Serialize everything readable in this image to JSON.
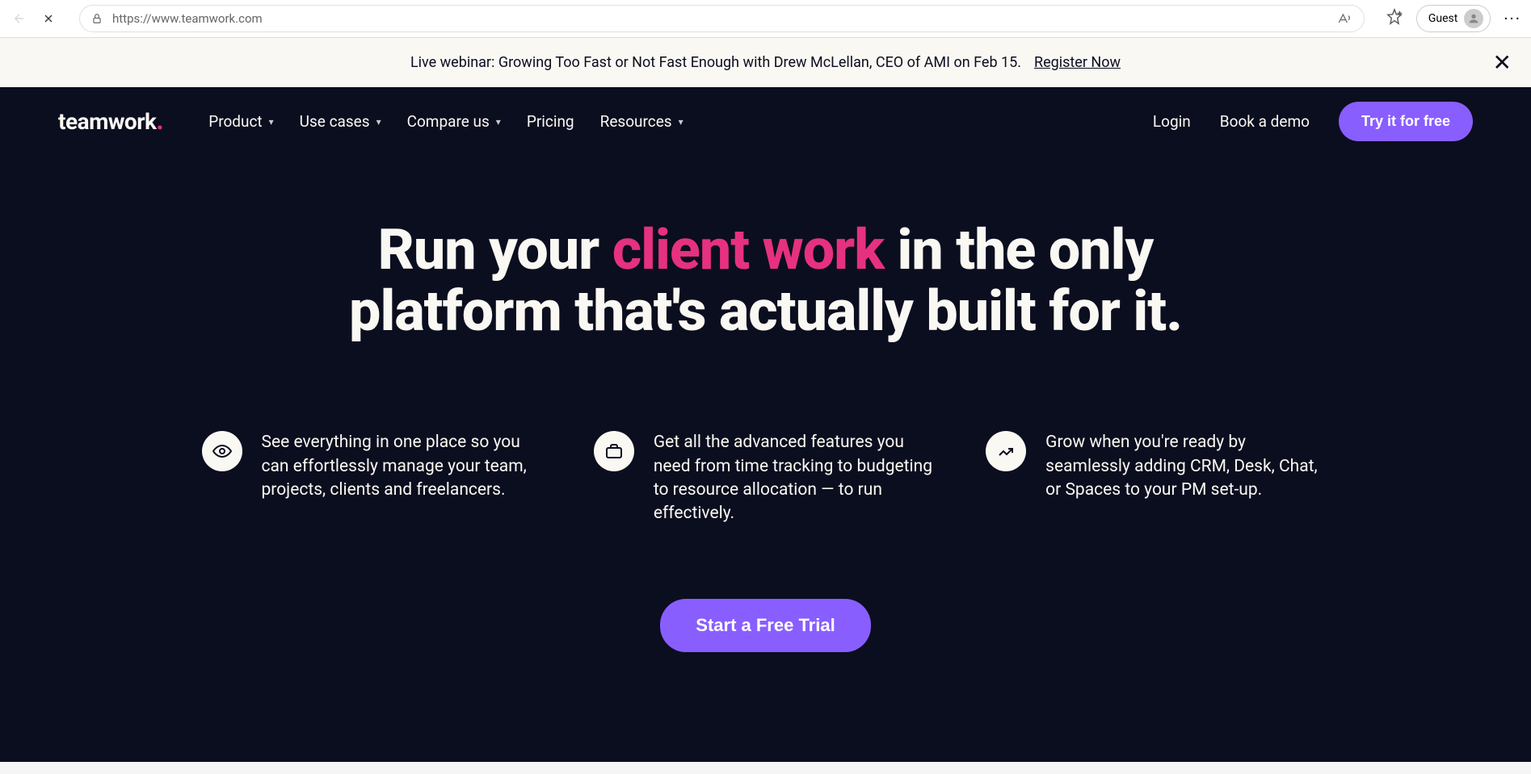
{
  "browser": {
    "url": "https://www.teamwork.com",
    "guest_label": "Guest"
  },
  "announcement": {
    "text": "Live webinar: Growing Too Fast or Not Fast Enough with Drew McLellan, CEO of AMI on Feb 15.",
    "link": "Register Now"
  },
  "nav": {
    "logo": "teamwork",
    "items": [
      {
        "label": "Product",
        "dropdown": true
      },
      {
        "label": "Use cases",
        "dropdown": true
      },
      {
        "label": "Compare us",
        "dropdown": true
      },
      {
        "label": "Pricing",
        "dropdown": false
      },
      {
        "label": "Resources",
        "dropdown": true
      }
    ],
    "login": "Login",
    "book_demo": "Book a demo",
    "cta": "Try it for free"
  },
  "hero": {
    "pre": "Run your ",
    "highlight": "client work",
    "post": " in the only platform that's actually built for it."
  },
  "features": [
    {
      "icon": "eye",
      "text": "See everything in one place so you can effortlessly manage your team, projects, clients and freelancers."
    },
    {
      "icon": "briefcase",
      "text": "Get all the advanced features you need from time tracking to budgeting to resource allocation — to run effectively."
    },
    {
      "icon": "trend",
      "text": "Grow when you're ready by seamlessly adding CRM, Desk, Chat, or Spaces to your PM set-up."
    }
  ],
  "bottom_cta": "Start a Free Trial",
  "colors": {
    "bg_dark": "#0b0e1f",
    "cream": "#faf8f3",
    "pink": "#e6317f",
    "purple": "#895eff"
  }
}
